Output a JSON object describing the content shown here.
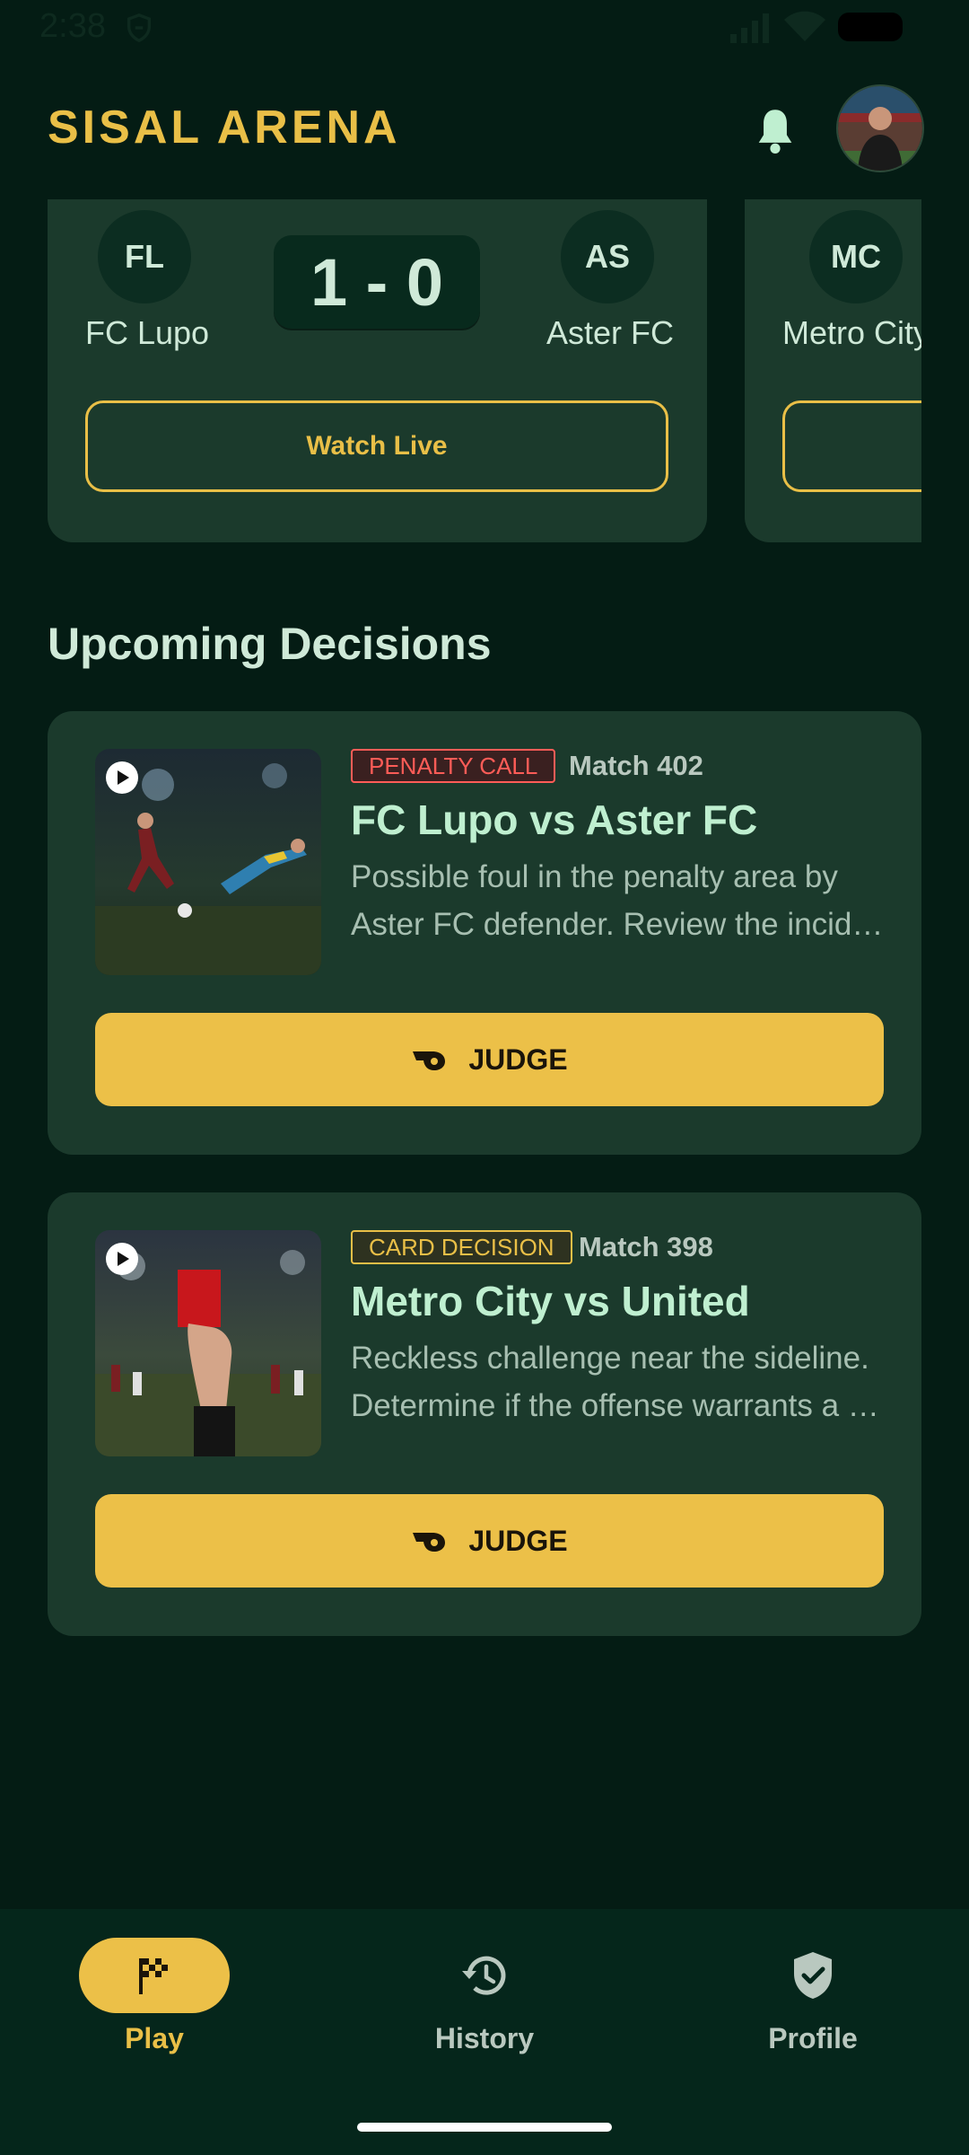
{
  "status_bar": {
    "time": "2:38"
  },
  "header": {
    "title": "SISAL ARENA"
  },
  "live_matches": [
    {
      "home_abbr": "FL",
      "home_name": "FC Lupo",
      "score": "1 - 0",
      "away_abbr": "AS",
      "away_name": "Aster FC",
      "button_label": "Watch Live"
    },
    {
      "home_abbr": "MC",
      "home_name": "Metro City"
    }
  ],
  "section": {
    "title": "Upcoming Decisions"
  },
  "decisions": [
    {
      "tag": "PENALTY CALL",
      "match": "Match 402",
      "title": "FC Lupo vs Aster FC",
      "desc_line1": "Possible foul in the penalty area by",
      "desc_line2": "Aster FC defender. Review the incident and decide.",
      "button_label": "JUDGE"
    },
    {
      "tag": "CARD DECISION",
      "match": "Match 398",
      "title": "Metro City vs United",
      "desc_line1": "Reckless challenge near the sideline.",
      "desc_line2": "Determine if the offense warrants a card.",
      "button_label": "JUDGE"
    }
  ],
  "nav": {
    "items": [
      {
        "label": "Play",
        "active": true
      },
      {
        "label": "History"
      },
      {
        "label": "Profile"
      }
    ]
  },
  "colors": {
    "accent": "#e9bf47",
    "background": "#041c14",
    "card": "#1b3a2c",
    "penalty": "#ff5c57"
  }
}
